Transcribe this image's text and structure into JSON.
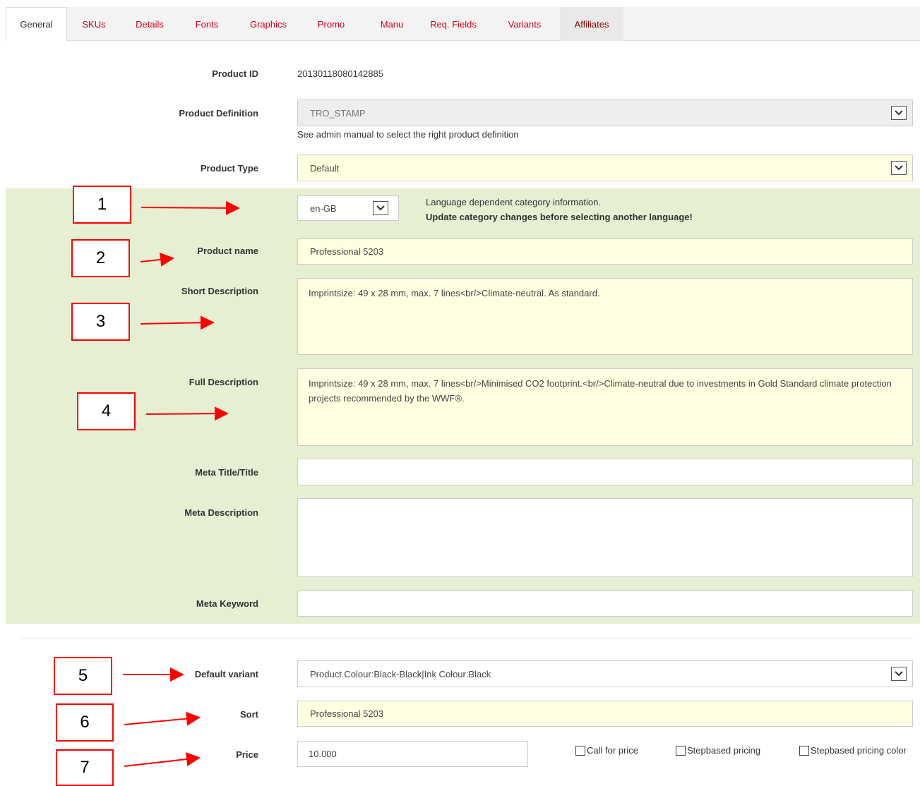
{
  "tabs": [
    {
      "label": "General"
    },
    {
      "label": "SKUs"
    },
    {
      "label": "Details"
    },
    {
      "label": "Fonts"
    },
    {
      "label": "Graphics"
    },
    {
      "label": "Promo"
    },
    {
      "label": "Manu"
    },
    {
      "label": "Req. Fields"
    },
    {
      "label": "Variants"
    },
    {
      "label": "Affiliates"
    }
  ],
  "product_id": {
    "label": "Product ID",
    "value": "20130118080142885"
  },
  "product_definition": {
    "label": "Product Definition",
    "value": "TRO_STAMP",
    "hint": "See admin manual to select the right product definition"
  },
  "product_type": {
    "label": "Product Type",
    "value": "Default"
  },
  "language": {
    "value": "en-GB",
    "info": "Language dependent category information.",
    "warning": "Update category changes before selecting another language!"
  },
  "product_name": {
    "label": "Product name",
    "value": "Professional 5203"
  },
  "short_description": {
    "label": "Short Description",
    "value": "Imprintsize: 49 x 28 mm, max. 7 lines<br/>Climate-neutral. As standard."
  },
  "full_description": {
    "label": "Full Description",
    "value": "Imprintsize: 49 x 28 mm, max. 7 lines<br/>Minimised CO2 footprint.<br/>Climate-neutral due to investments in Gold Standard climate protection projects recommended by the WWF®."
  },
  "meta_title": {
    "label": "Meta Title/Title",
    "value": ""
  },
  "meta_description": {
    "label": "Meta Description",
    "value": ""
  },
  "meta_keyword": {
    "label": "Meta Keyword",
    "value": ""
  },
  "default_variant": {
    "label": "Default variant",
    "value": "Product Colour:Black-Black|Ink Colour:Black"
  },
  "sort": {
    "label": "Sort",
    "value": "Professional 5203"
  },
  "price": {
    "label": "Price",
    "value": "10.000"
  },
  "checkboxes": {
    "call_for_price": "Call for price",
    "stepbased_pricing": "Stepbased pricing",
    "stepbased_pricing_color": "Stepbased pricing color"
  },
  "callouts": [
    "1",
    "2",
    "3",
    "4",
    "5",
    "6",
    "7"
  ],
  "colors": {
    "accent_tab": "#d0021b",
    "green_section": "#e6efd2",
    "input_yellow": "#fefee0",
    "callout_red": "#ff0000"
  }
}
